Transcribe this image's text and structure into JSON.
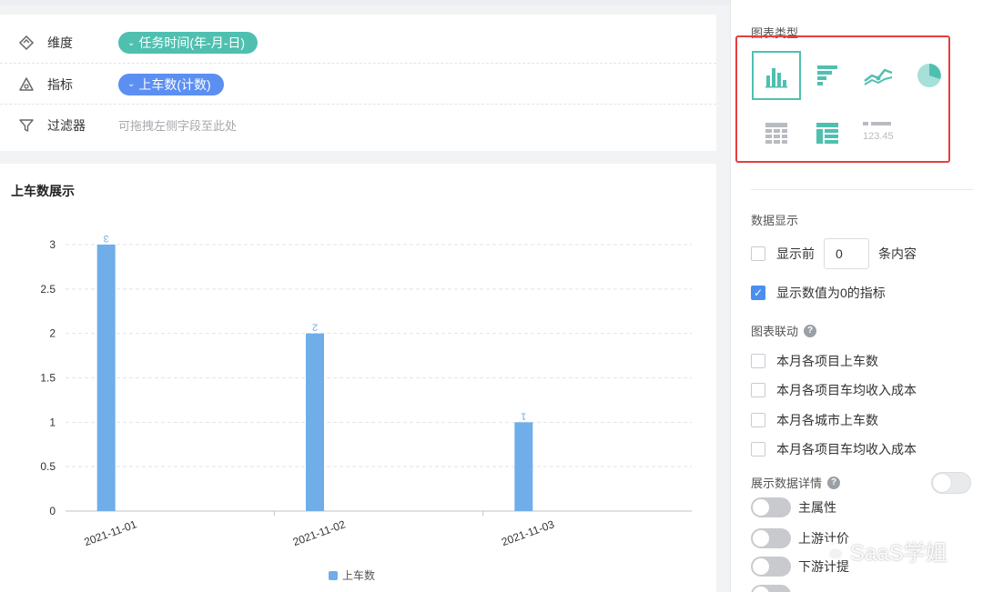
{
  "fields": {
    "dimension": {
      "label": "维度",
      "value": "任务时间(年-月-日)",
      "icon": "dimension-icon"
    },
    "metric": {
      "label": "指标",
      "value": "上车数(计数)",
      "icon": "metric-icon"
    },
    "filter": {
      "label": "过滤器",
      "placeholder": "可拖拽左侧字段至此处",
      "icon": "filter-icon"
    }
  },
  "chart_data": {
    "type": "bar",
    "title": "上车数展示",
    "categories": [
      "2021-11-01",
      "2021-11-02",
      "2021-11-03"
    ],
    "series": [
      {
        "name": "上车数",
        "values": [
          3,
          2,
          1
        ],
        "color": "#6faee8"
      }
    ],
    "data_labels": [
      "3",
      "2",
      "1"
    ],
    "y_ticks": [
      "0",
      "0.5",
      "1",
      "1.5",
      "2",
      "2.5",
      "3"
    ],
    "ylim": [
      0,
      3
    ],
    "grid": true,
    "legend": "bottom"
  },
  "panel": {
    "chart_types_title": "图表类型",
    "chart_types": [
      {
        "name": "column-chart-icon",
        "selected": true
      },
      {
        "name": "bar-chart-icon",
        "selected": false
      },
      {
        "name": "line-chart-icon",
        "selected": false
      },
      {
        "name": "pie-chart-icon",
        "selected": false
      },
      {
        "name": "cross-table-icon",
        "selected": false
      },
      {
        "name": "detail-table-icon",
        "selected": false
      },
      {
        "name": "indicator-card-icon",
        "text": "123.45",
        "selected": false
      }
    ],
    "data_display_title": "数据显示",
    "show_top_prefix": "显示前",
    "show_top_value": "0",
    "show_top_suffix": "条内容",
    "show_zero_label": "显示数值为0的指标",
    "linkage_title": "图表联动",
    "linkage_items": [
      "本月各项目上车数",
      "本月各项目车均收入成本",
      "本月各城市上车数",
      "本月各项目车均收入成本"
    ],
    "details_title": "展示数据详情",
    "details_items": [
      "主属性",
      "上游计价",
      "下游计提"
    ],
    "help_glyph": "?"
  },
  "watermark": "SaaS学姐"
}
